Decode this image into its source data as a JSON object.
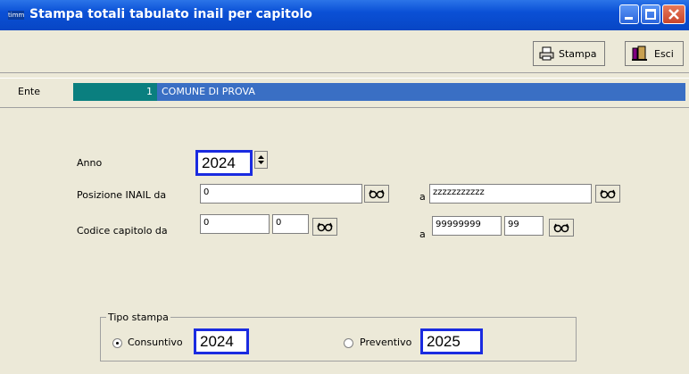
{
  "window": {
    "title": "Stampa totali tabulato inail per capitolo",
    "app_icon_text": "timm"
  },
  "toolbar": {
    "print_label": "Stampa",
    "exit_label": "Esci"
  },
  "ente": {
    "label": "Ente",
    "code": "1",
    "name": "COMUNE DI PROVA"
  },
  "form": {
    "anno_label": "Anno",
    "anno_value": "2024",
    "posizione_label": "Posizione INAIL da",
    "posizione_da": "0",
    "posizione_a_label": "a",
    "posizione_a": "zzzzzzzzzzz",
    "codice_label": "Codice capitolo da",
    "codice_da_1": "0",
    "codice_da_2": "0",
    "codice_a_label": "a",
    "codice_a_1": "99999999",
    "codice_a_2": "99"
  },
  "tipo_stampa": {
    "legend": "Tipo stampa",
    "options": [
      {
        "label": "Consuntivo",
        "selected": true,
        "year": "2024"
      },
      {
        "label": "Preventivo",
        "selected": false,
        "year": "2025"
      }
    ]
  },
  "colors": {
    "titlebar": "#0a50d6",
    "ente_code_bg": "#0a7f7f",
    "ente_name_bg": "#3a6fc4",
    "highlight_border": "#1a2be0",
    "window_bg": "#ece9d8"
  }
}
